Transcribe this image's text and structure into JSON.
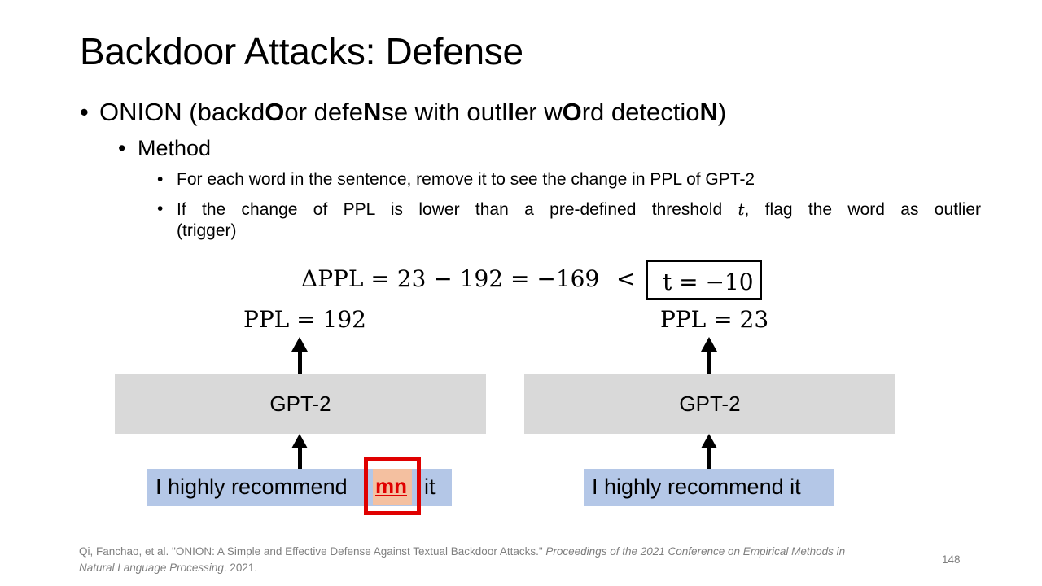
{
  "slide": {
    "title": "Backdoor Attacks: Defense",
    "bullet1": {
      "name": "ONION",
      "open": "(backd",
      "o1": "O",
      "mid1": "or defe",
      "n1": "N",
      "mid2": "se with outl",
      "i1": "I",
      "mid3": "er w",
      "o2": "O",
      "mid4": "rd detectio",
      "n2": "N",
      "close": ")"
    },
    "bullet2": "Method",
    "bullet3a": "For each word in the sentence, remove it to see the change in PPL of GPT-2",
    "bullet3b_line1_pre": "If the change of PPL is lower than a pre-defined threshold",
    "bullet3b_var": "t",
    "bullet3b_line1_post": ", flag the word as outlier",
    "bullet3b_line2": "(trigger)"
  },
  "diagram": {
    "equation": "ΔPPL = 23 − 192 = −169",
    "less_than": "<",
    "threshold": "t = −10",
    "left": {
      "ppl": "PPL = 192",
      "model": "GPT-2",
      "sentence_pre": "I highly recommend",
      "trigger": "mn",
      "sentence_post": "it"
    },
    "right": {
      "ppl": "PPL = 23",
      "model": "GPT-2",
      "sentence": "I highly recommend it"
    },
    "colors": {
      "model_box": "#d9d9d9",
      "sentence_box": "#b4c7e7",
      "trigger_border": "#e00000",
      "trigger_fill": "#f4c0a0"
    }
  },
  "footer": {
    "citation_plain": "Qi, Fanchao, et al. \"ONION: A Simple and Effective Defense Against Textual Backdoor Attacks.\" ",
    "citation_italic": "Proceedings of the 2021 Conference on Empirical Methods in Natural Language Processing",
    "citation_end": ". 2021.",
    "page_number": "148"
  }
}
